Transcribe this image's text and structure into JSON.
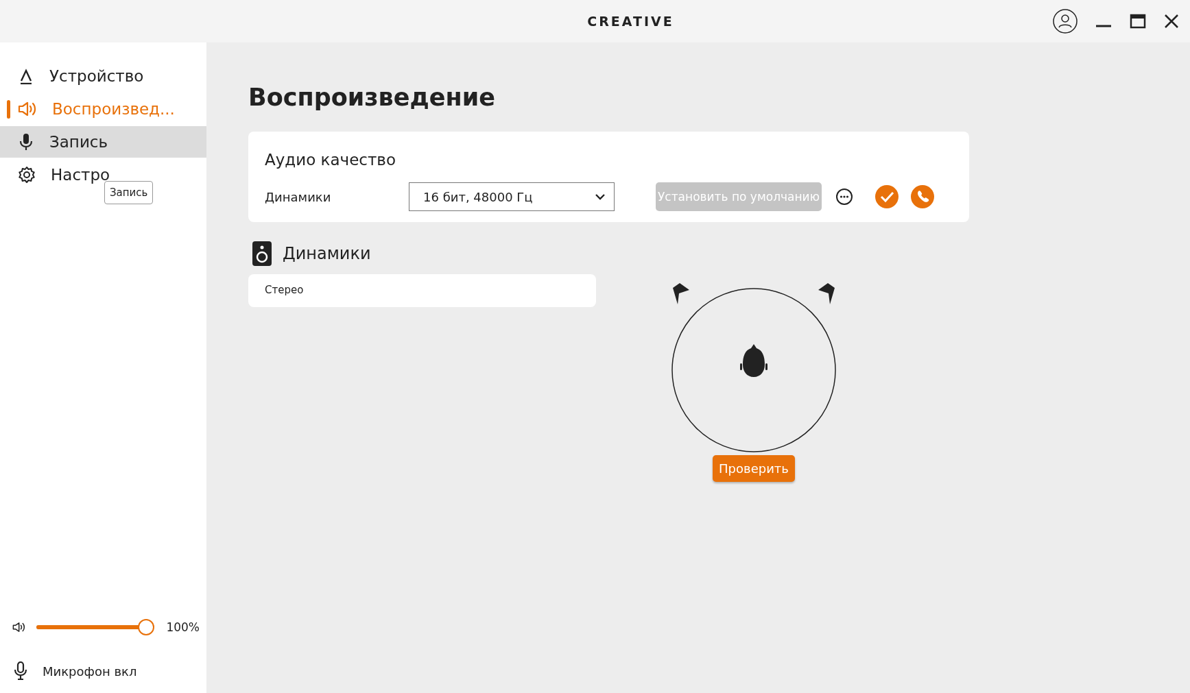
{
  "window": {
    "logo": "CREATIVE"
  },
  "sidebar": {
    "items": [
      {
        "kind": "device",
        "label": "Устройство",
        "selected": false,
        "hovered": false
      },
      {
        "kind": "playback",
        "label": "Воспроизвед...",
        "selected": true,
        "hovered": false
      },
      {
        "kind": "record",
        "label": "Запись",
        "selected": false,
        "hovered": true
      },
      {
        "kind": "settings",
        "label": "Настро",
        "selected": false,
        "hovered": false
      }
    ],
    "tooltip": "Запись",
    "volume": {
      "level": 1.0,
      "reading": "100%"
    },
    "mic": {
      "label": "Микрофон вкл"
    }
  },
  "page": {
    "title": "Воспроизведение",
    "audio_quality": {
      "title": "Аудио качество",
      "label": "Динамики",
      "value": "16 бит, 48000 Гц",
      "default_button": {
        "label": "Установить по умолчанию",
        "disabled": true
      }
    },
    "speakers": {
      "title": "Динамики",
      "mode": "Стерео",
      "test_button": "Проверить"
    }
  }
}
